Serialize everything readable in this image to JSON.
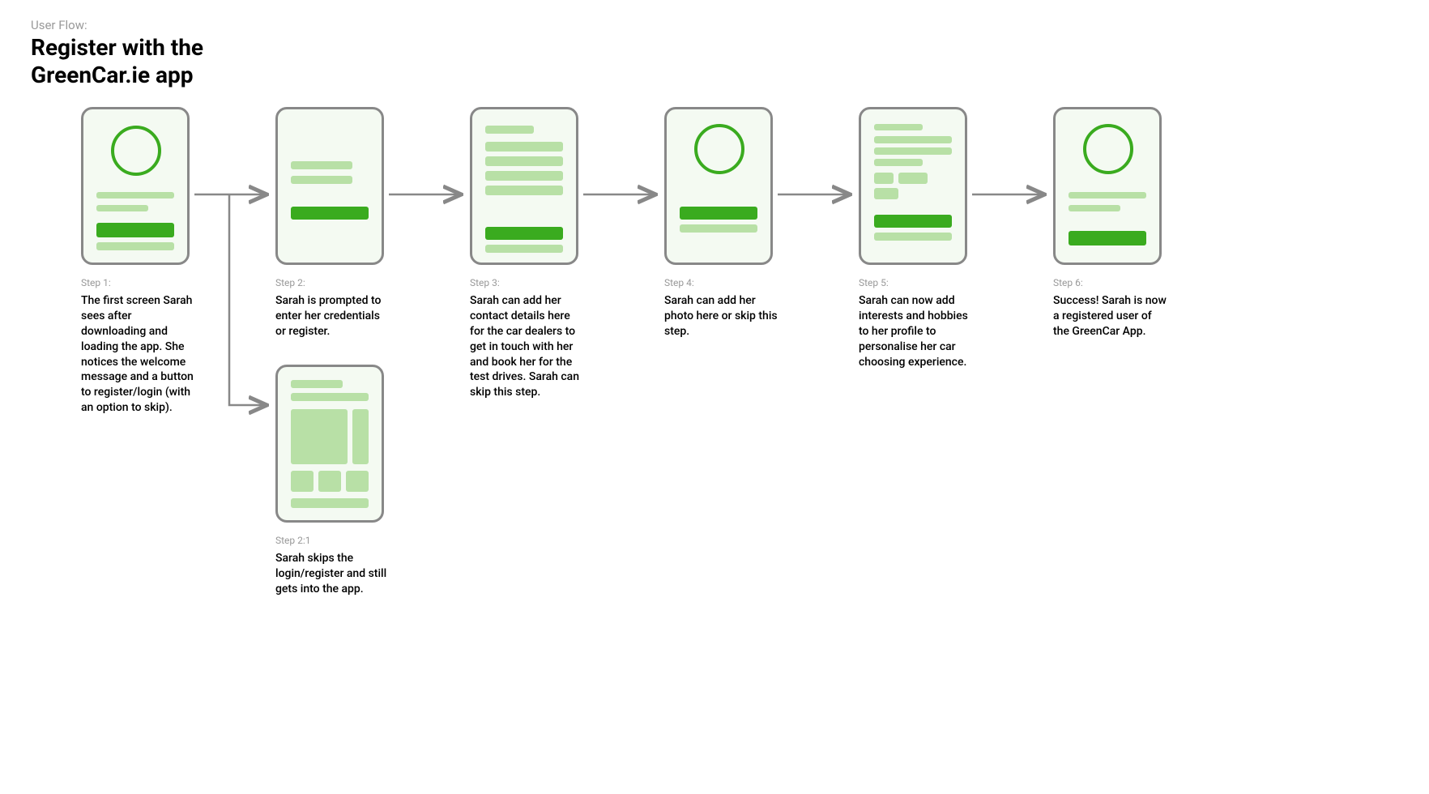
{
  "header": {
    "label": "User Flow:",
    "title": "Register with the\nGreenCar.ie app"
  },
  "steps": {
    "s1": {
      "label": "Step 1:",
      "desc": "The first screen Sarah sees after downloading and loading the app. She notices the welcome message and a button to register/login (with an option to skip)."
    },
    "s2": {
      "label": "Step 2:",
      "desc": "Sarah is prompted to enter her credentials or register."
    },
    "s21": {
      "label": "Step 2:1",
      "desc": "Sarah skips the login/register and still gets into the app."
    },
    "s3": {
      "label": "Step 3:",
      "desc": "Sarah can add her contact details here for the car dealers to get in touch with her and book her for the test drives. Sarah can skip this step."
    },
    "s4": {
      "label": "Step 4:",
      "desc": "Sarah can add her photo here or skip this step."
    },
    "s5": {
      "label": "Step 5:",
      "desc": "Sarah can now add interests and hobbies to her profile to personalise her car choosing experience."
    },
    "s6": {
      "label": "Step 6:",
      "desc": "Success! Sarah is now a registered user of the GreenCar App."
    }
  }
}
